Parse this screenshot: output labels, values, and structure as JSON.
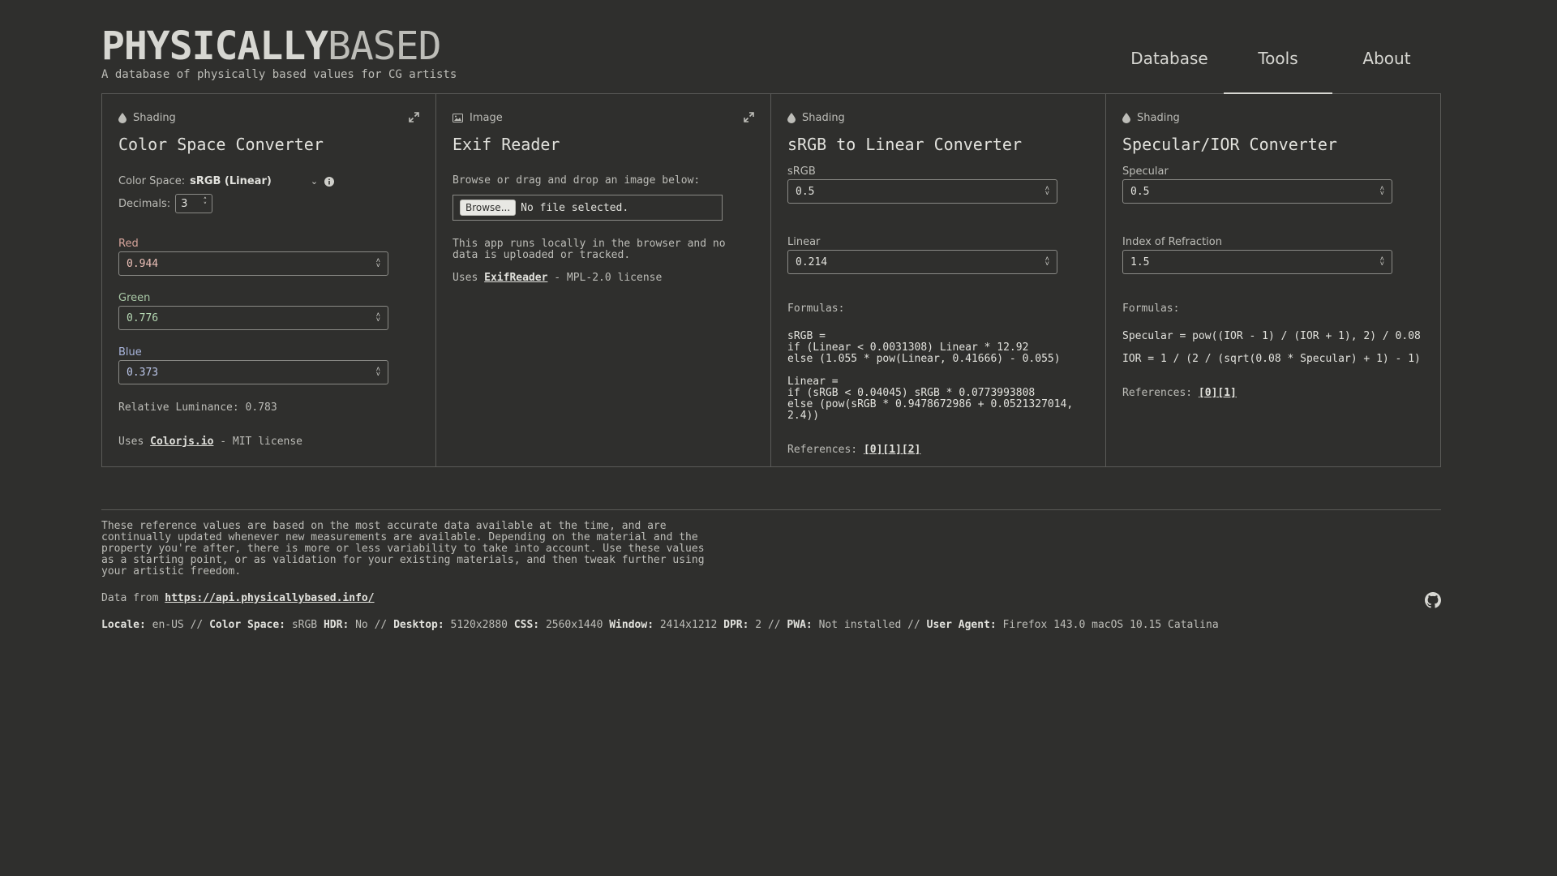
{
  "header": {
    "logo_bold": "PHYSICALLY",
    "logo_light": "BASED",
    "tagline": "A database of physically based values for CG artists",
    "nav": [
      {
        "label": "Database",
        "active": false
      },
      {
        "label": "Tools",
        "active": true
      },
      {
        "label": "About",
        "active": false
      }
    ]
  },
  "panels": {
    "color_space": {
      "category": "Shading",
      "title": "Color Space Converter",
      "color_space_label": "Color Space:",
      "color_space_value": "sRGB (Linear)",
      "decimals_label": "Decimals:",
      "decimals_value": "3",
      "red_label": "Red",
      "red_value": "0.944",
      "green_label": "Green",
      "green_value": "0.776",
      "blue_label": "Blue",
      "blue_value": "0.373",
      "luminance": "Relative Luminance: 0.783",
      "uses_prefix": "Uses",
      "uses_link": "Colorjs.io",
      "uses_suffix": "- MIT license"
    },
    "exif": {
      "category": "Image",
      "title": "Exif Reader",
      "instruction": "Browse or drag and drop an image below:",
      "browse_label": "Browse...",
      "no_file": "No file selected.",
      "note": "This app runs locally in the browser and no data is uploaded or tracked.",
      "uses_prefix": "Uses",
      "uses_link": "ExifReader",
      "uses_suffix": "- MPL-2.0 license"
    },
    "srgb_linear": {
      "category": "Shading",
      "title": "sRGB to Linear Converter",
      "srgb_label": "sRGB",
      "srgb_value": "0.5",
      "linear_label": "Linear",
      "linear_value": "0.214",
      "formulas_label": "Formulas:",
      "formula1_l1": "sRGB =",
      "formula1_l2": "if (Linear < 0.0031308) Linear * 12.92",
      "formula1_l3": "else (1.055 * pow(Linear, 0.41666) - 0.055)",
      "formula2_l1": "Linear =",
      "formula2_l2": "if (sRGB < 0.04045) sRGB * 0.0773993808",
      "formula2_l3": "else (pow(sRGB * 0.9478672986 + 0.0521327014, 2.4))",
      "references_label": "References:",
      "references": "[0][1][2]"
    },
    "specular_ior": {
      "category": "Shading",
      "title": "Specular/IOR Converter",
      "specular_label": "Specular",
      "specular_value": "0.5",
      "ior_label": "Index of Refraction",
      "ior_value": "1.5",
      "formulas_label": "Formulas:",
      "formula1": "Specular = pow((IOR - 1) / (IOR + 1), 2) / 0.08",
      "formula2": "IOR = 1 / (2 / (sqrt(0.08 * Specular) + 1) - 1)",
      "references_label": "References:",
      "references": "[0][1]"
    }
  },
  "footer": {
    "disclaimer": "These reference values are based on the most accurate data available at the time, and are continually updated whenever new measurements are available. Depending on the material and the property you're after, there is more or less variability to take into account. Use these values as a starting point, or as validation for your existing materials, and then tweak further using your artistic freedom.",
    "data_from_label": "Data from",
    "data_from_link": "https://api.physicallybased.info/",
    "sys": {
      "locale_label": "Locale:",
      "locale": "en-US",
      "colorspace_label": "Color Space:",
      "colorspace": "sRGB",
      "hdr_label": "HDR:",
      "hdr": "No",
      "desktop_label": "Desktop:",
      "desktop": "5120x2880",
      "css_label": "CSS:",
      "css": "2560x1440",
      "window_label": "Window:",
      "window": "2414x1212",
      "dpr_label": "DPR:",
      "dpr": "2",
      "pwa_label": "PWA:",
      "pwa": "Not installed",
      "ua_label": "User Agent:",
      "ua": "Firefox 143.0 macOS 10.15 Catalina",
      "sep": "//"
    }
  },
  "icons": {
    "shading": "droplet-icon",
    "image": "image-icon",
    "expand": "expand-icon",
    "info": "info-icon",
    "github": "github-icon"
  }
}
